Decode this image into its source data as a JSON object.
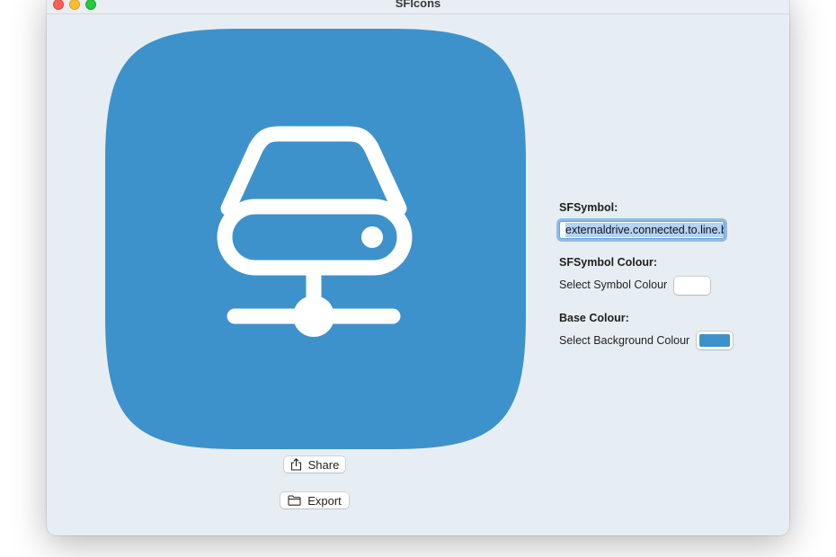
{
  "window": {
    "title": "SFIcons"
  },
  "preview": {
    "symbol_name": "externaldrive.connected.to.line.below",
    "background_color": "#3d92cc",
    "symbol_color": "#ffffff",
    "icon": "externaldrive-connected-to-line-below-icon"
  },
  "actions": {
    "share_label": "Share",
    "share_icon": "share-icon",
    "export_label": "Export",
    "export_icon": "folder-icon"
  },
  "settings": {
    "symbol_heading": "SFSymbol:",
    "symbol_value": "externaldrive.connected.to.line.below",
    "symbol_colour_heading": "SFSymbol Colour:",
    "symbol_colour_label": "Select Symbol Colour",
    "symbol_colour_value": "#ffffff",
    "base_colour_heading": "Base Colour:",
    "base_colour_label": "Select Background Colour",
    "base_colour_value": "#3d92cc"
  }
}
